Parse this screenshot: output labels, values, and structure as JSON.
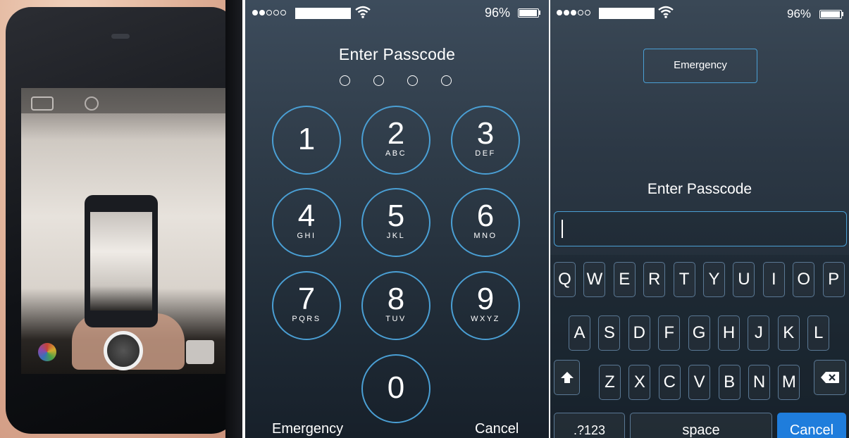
{
  "photo_panel": {
    "description_icons": [
      "camera-icon",
      "flip-camera-icon",
      "shutter-button",
      "photo-thumbnail",
      "filters-icon"
    ]
  },
  "numeric_lock": {
    "status": {
      "signal_filled": 2,
      "signal_total": 5,
      "battery_text": "96%",
      "battery_level": 0.96
    },
    "title": "Enter Passcode",
    "passcode_dots": 4,
    "keys": [
      {
        "num": "1",
        "letters": ""
      },
      {
        "num": "2",
        "letters": "ABC"
      },
      {
        "num": "3",
        "letters": "DEF"
      },
      {
        "num": "4",
        "letters": "GHI"
      },
      {
        "num": "5",
        "letters": "JKL"
      },
      {
        "num": "6",
        "letters": "MNO"
      },
      {
        "num": "7",
        "letters": "PQRS"
      },
      {
        "num": "8",
        "letters": "TUV"
      },
      {
        "num": "9",
        "letters": "WXYZ"
      },
      {
        "num": "0",
        "letters": ""
      }
    ],
    "emergency_label": "Emergency",
    "cancel_label": "Cancel"
  },
  "alpha_lock": {
    "status": {
      "signal_filled": 3,
      "signal_total": 5,
      "battery_text": "96%",
      "battery_level": 0.96
    },
    "emergency_label": "Emergency",
    "title": "Enter Passcode",
    "input_value": "",
    "keyboard": {
      "row1": [
        "Q",
        "W",
        "E",
        "R",
        "T",
        "Y",
        "U",
        "I",
        "O",
        "P"
      ],
      "row2": [
        "A",
        "S",
        "D",
        "F",
        "G",
        "H",
        "J",
        "K",
        "L"
      ],
      "row3": [
        "Z",
        "X",
        "C",
        "V",
        "B",
        "N",
        "M"
      ],
      "numbers_label": ".?123",
      "space_label": "space",
      "cancel_label": "Cancel",
      "shift_icon": "shift-icon",
      "delete_icon": "delete-icon"
    },
    "accent_color": "#1f7ddc"
  },
  "colors": {
    "ring": "#4a9fd4",
    "cancel_key": "#1f7ddc"
  }
}
